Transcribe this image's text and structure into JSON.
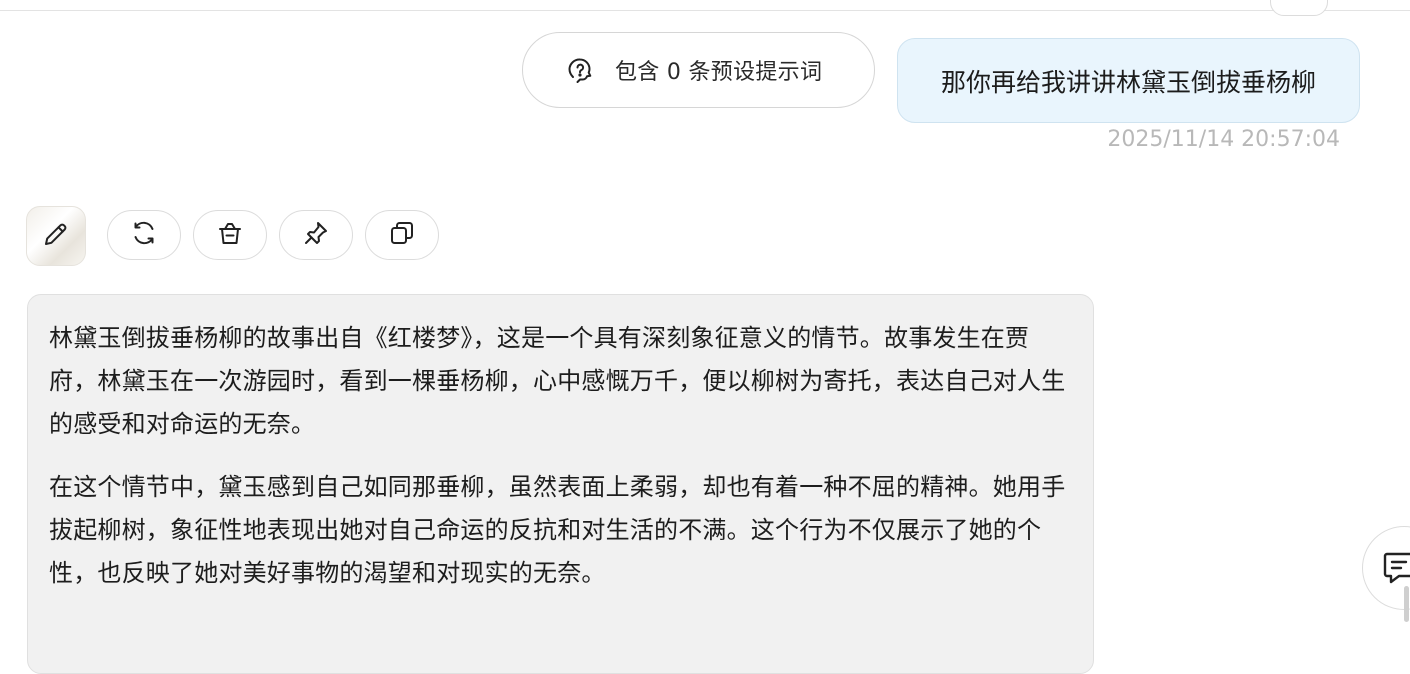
{
  "user_message": {
    "text": "那你再给我讲讲林黛玉倒拔垂杨柳",
    "timestamp": "2025/11/14 20:57:04"
  },
  "preset_prompts": {
    "label": "包含 0 条预设提示词"
  },
  "assistant_message": {
    "paragraphs": [
      "林黛玉倒拔垂杨柳的故事出自《红楼梦》，这是一个具有深刻象征意义的情节。故事发生在贾府，林黛玉在一次游园时，看到一棵垂杨柳，心中感慨万千，便以柳树为寄托，表达自己对人生的感受和对命运的无奈。",
      "在这个情节中，黛玉感到自己如同那垂柳，虽然表面上柔弱，却也有着一种不屈的精神。她用手拔起柳树，象征性地表现出她对自己命运的反抗和对生活的不满。这个行为不仅展示了她的个性，也反映了她对美好事物的渴望和对现实的无奈。"
    ]
  },
  "actions": [
    {
      "name": "edit",
      "icon": "pencil-icon"
    },
    {
      "name": "regenerate",
      "icon": "refresh-icon"
    },
    {
      "name": "delete",
      "icon": "trash-icon"
    },
    {
      "name": "pin",
      "icon": "pin-icon"
    },
    {
      "name": "copy",
      "icon": "copy-icon"
    }
  ],
  "colors": {
    "user_bubble_bg": "#e9f5fd",
    "assistant_bubble_bg": "#f1f1f1",
    "timestamp": "#b8b8b8"
  }
}
